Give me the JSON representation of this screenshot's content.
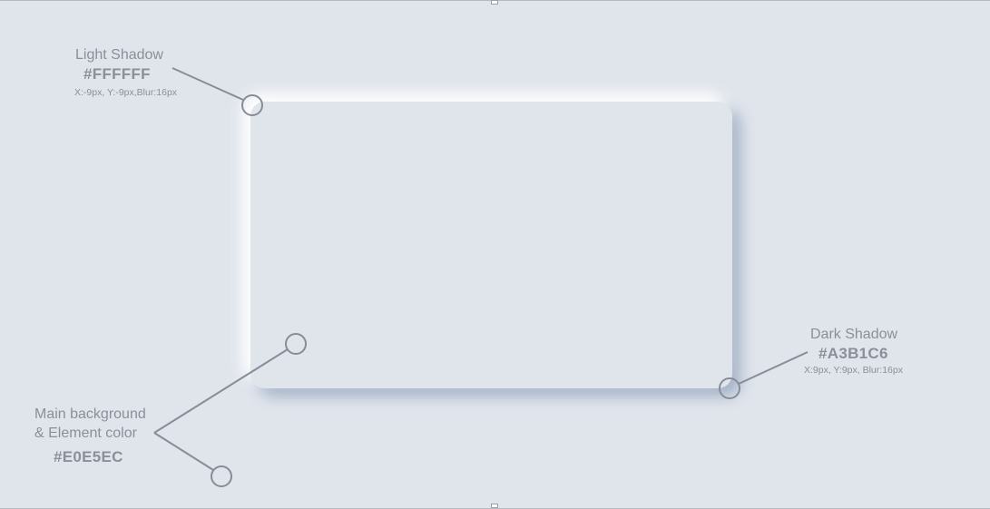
{
  "colors": {
    "background": "#E0E5EC",
    "light_shadow": "#FFFFFF",
    "dark_shadow": "#A3B1C6",
    "annotation": "#878c98"
  },
  "light_shadow": {
    "title": "Light Shadow",
    "hex": "#FFFFFF",
    "params": "X:-9px, Y:-9px,Blur:16px"
  },
  "dark_shadow": {
    "title": "Dark Shadow",
    "hex": "#A3B1C6",
    "params": "X:9px, Y:9px, Blur:16px"
  },
  "main_background": {
    "title_line1": "Main background",
    "title_line2": "& Element color",
    "hex": "#E0E5EC"
  }
}
